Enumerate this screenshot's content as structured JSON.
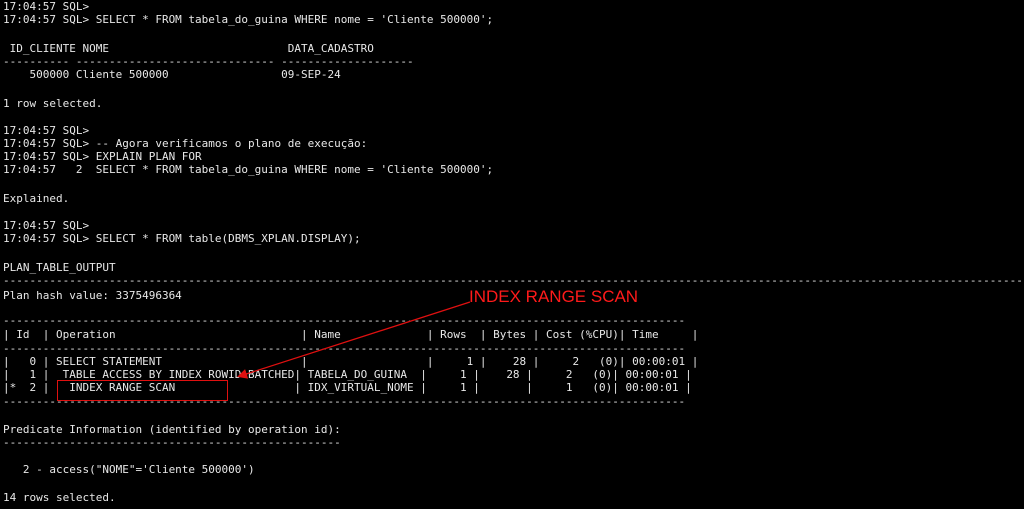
{
  "terminal": {
    "lines": [
      "17:04:57 SQL>",
      "17:04:57 SQL> SELECT * FROM tabela_do_guina WHERE nome = 'Cliente 500000';",
      " ID_CLIENTE NOME                           DATA_CADASTRO",
      "---------- ------------------------------ --------------------",
      "    500000 Cliente 500000                 09-SEP-24",
      "1 row selected.",
      "17:04:57 SQL>",
      "17:04:57 SQL> -- Agora verificamos o plano de execução:",
      "17:04:57 SQL> EXPLAIN PLAN FOR",
      "17:04:57   2  SELECT * FROM tabela_do_guina WHERE nome = 'Cliente 500000';",
      "Explained.",
      "17:04:57 SQL>",
      "17:04:57 SQL> SELECT * FROM table(DBMS_XPLAN.DISPLAY);",
      "PLAN_TABLE_OUTPUT",
      "Plan hash value: 3375496364",
      "| Id  | Operation                            | Name             | Rows  | Bytes | Cost (%CPU)| Time     |",
      "|   0 | SELECT STATEMENT                     |                  |     1 |    28 |     2   (0)| 00:00:01 |",
      "|   1 |  TABLE ACCESS BY INDEX ROWID BATCHED| TABELA_DO_GUINA  |     1 |    28 |     2   (0)| 00:00:01 |",
      "|*  2 |   INDEX RANGE SCAN                  | IDX_VIRTUAL_NOME |     1 |       |     1   (0)| 00:00:01 |",
      "Predicate Information (identified by operation id):",
      "   2 - access(\"NOME\"='Cliente 500000')",
      "14 rows selected."
    ],
    "rule_long": "----------------------------------------------------------------------------------------------------------------------------------------------------------------",
    "rule_mid": "-------------------------------------------------------------------------------------------------------",
    "rule_short": "---------------------------------------------------"
  },
  "annotation": {
    "label": "INDEX RANGE SCAN",
    "color": "#ff1a1a"
  }
}
